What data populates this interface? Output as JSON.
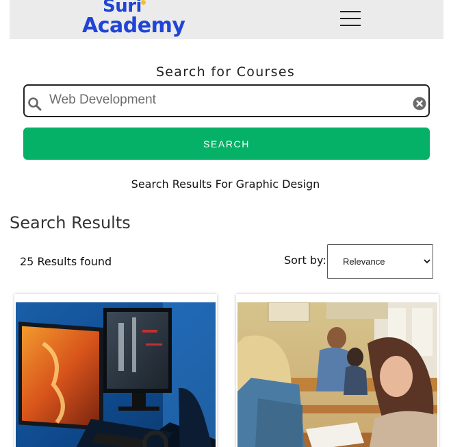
{
  "header": {
    "logo_line1": "Suri",
    "logo_line2": "Academy",
    "menu_icon": "hamburger-menu-icon"
  },
  "search": {
    "title": "Search for Courses",
    "value": "Web Development",
    "search_icon": "search-icon",
    "clear_icon": "clear-icon",
    "button_label": "SEARCH"
  },
  "results": {
    "search_results_for": "Search Results For Graphic Design",
    "section_title": "Search Results",
    "count_text": "25 Results found",
    "sort_label": "Sort by:",
    "sort_selected": "Relevance"
  },
  "colors": {
    "brand_blue": "#1f44d6",
    "button_green": "#05b167",
    "header_bg": "#ebebeb"
  },
  "cards": [
    {
      "image": "gaming-computer-monitors-photo"
    },
    {
      "image": "students-in-classroom-photo"
    }
  ]
}
